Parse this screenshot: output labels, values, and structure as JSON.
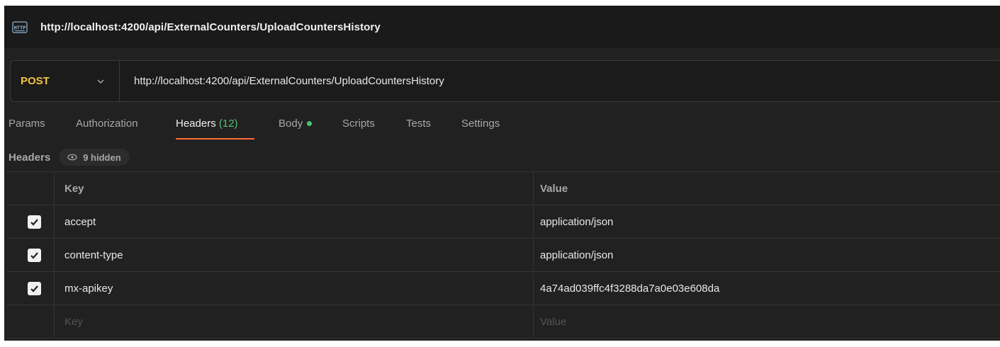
{
  "window": {
    "title": "http://localhost:4200/api/ExternalCounters/UploadCountersHistory",
    "icon": "http-icon"
  },
  "request": {
    "method": "POST",
    "method_color": "#f4c542",
    "url": "http://localhost:4200/api/ExternalCounters/UploadCountersHistory"
  },
  "tabs": [
    {
      "label": "Params"
    },
    {
      "label": "Authorization"
    },
    {
      "label": "Headers",
      "count": "(12)",
      "active": true
    },
    {
      "label": "Body",
      "dot": true
    },
    {
      "label": "Scripts"
    },
    {
      "label": "Tests"
    },
    {
      "label": "Settings"
    }
  ],
  "headers_section": {
    "label": "Headers",
    "hidden_label": "9 hidden"
  },
  "table": {
    "columns": {
      "key": "Key",
      "value": "Value"
    },
    "rows": [
      {
        "checked": true,
        "key": "accept",
        "value": "application/json"
      },
      {
        "checked": true,
        "key": "content-type",
        "value": "application/json"
      },
      {
        "checked": true,
        "key": "mx-apikey",
        "value": "4a74ad039ffc4f3288da7a0e03e608da"
      }
    ],
    "placeholder": {
      "key": "Key",
      "value": "Value"
    }
  },
  "colors": {
    "accent": "#ff6c37",
    "success": "#4ec36c",
    "background": "#212121"
  }
}
